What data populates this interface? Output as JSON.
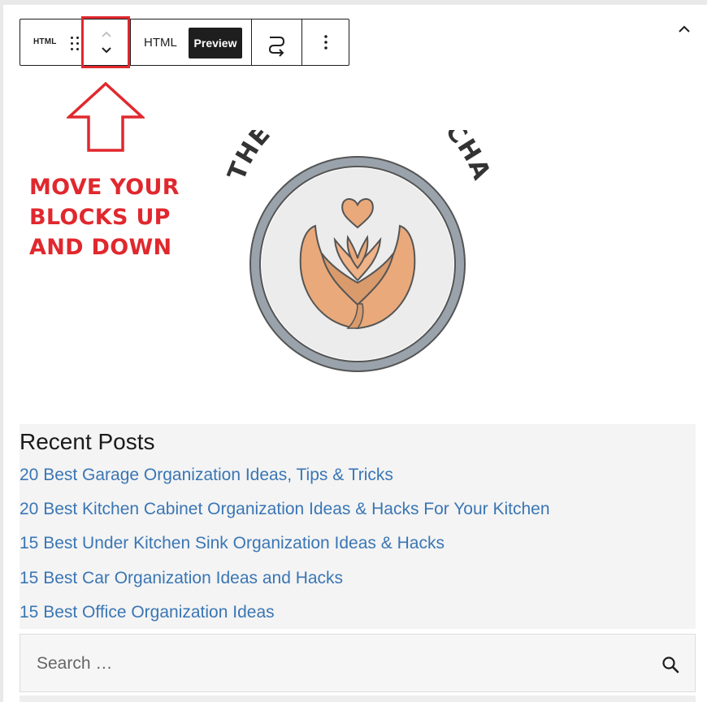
{
  "toolbar": {
    "block_icon_label": "HTML",
    "tab_html": "HTML",
    "tab_preview": "Preview",
    "icons": [
      "drag-handle-icon",
      "chevron-up-icon",
      "chevron-down-icon",
      "transform-icon",
      "more-options-icon"
    ]
  },
  "annotation": {
    "lines": [
      "MOVE YOUR",
      "BLOCKS UP",
      "AND DOWN"
    ],
    "color": "#e0282e"
  },
  "logo": {
    "text": "THE MODERN MOCHA"
  },
  "recent_posts": {
    "title": "Recent Posts",
    "items": [
      "20 Best Garage Organization Ideas, Tips & Tricks",
      "20 Best Kitchen Cabinet Organization Ideas & Hacks For Your Kitchen",
      "15 Best Under Kitchen Sink Organization Ideas & Hacks",
      "15 Best Car Organization Ideas and Hacks",
      "15 Best Office Organization Ideas"
    ],
    "link_color": "#3a76b4"
  },
  "search": {
    "placeholder": "Search …",
    "value": ""
  }
}
